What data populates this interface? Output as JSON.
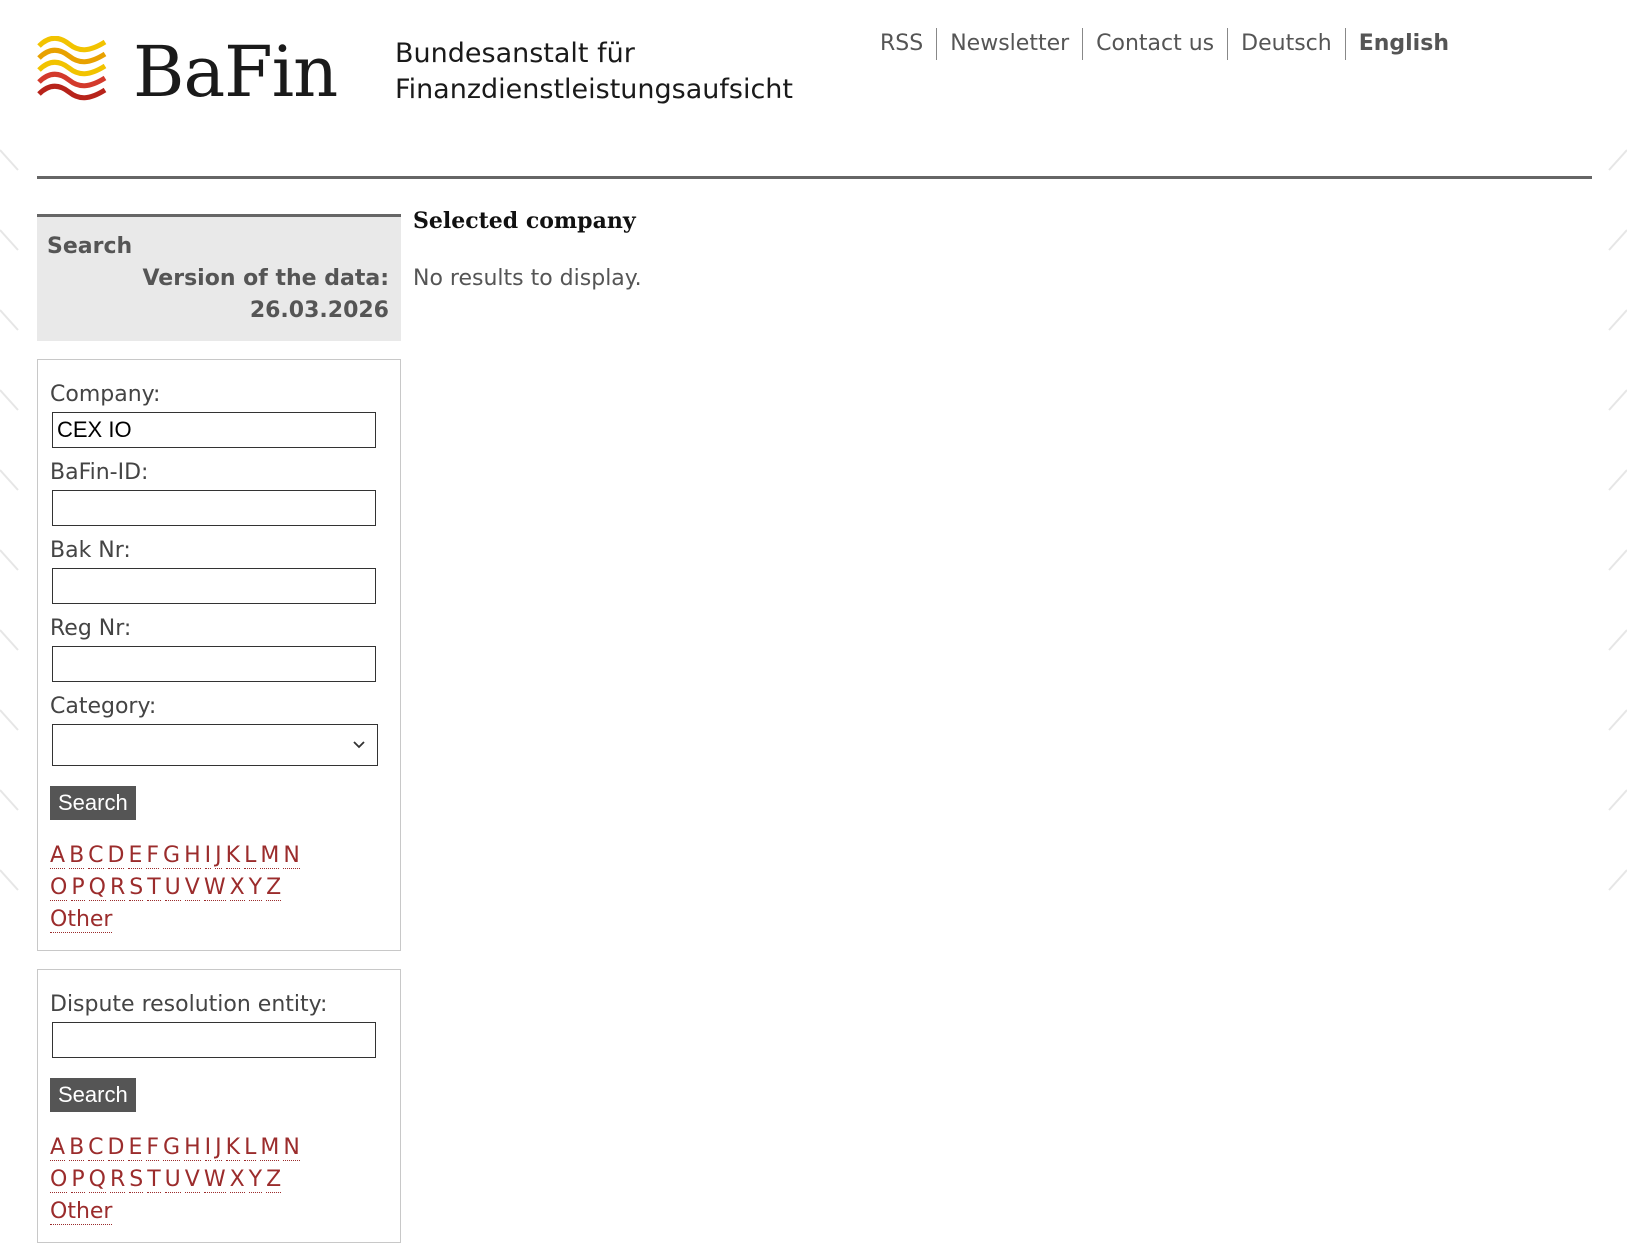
{
  "header": {
    "brand": "BaFin",
    "subtitle_line1": "Bundesanstalt für",
    "subtitle_line2": "Finanzdienstleistungsaufsicht",
    "nav": [
      "RSS",
      "Newsletter",
      "Contact us",
      "Deutsch",
      "English"
    ],
    "active_nav": "English"
  },
  "sidebar": {
    "title": "Search",
    "version_label": "Version of the data:",
    "version_date": "26.03.2026",
    "company_label": "Company:",
    "company_value": "CEX IO",
    "bafin_id_label": "BaFin-ID:",
    "bak_label": "Bak Nr:",
    "reg_label": "Reg Nr:",
    "category_label": "Category:",
    "search_button": "Search",
    "letters_row1": [
      "A",
      "B",
      "C",
      "D",
      "E",
      "F",
      "G",
      "H",
      "I",
      "J",
      "K",
      "L",
      "M",
      "N"
    ],
    "letters_row2": [
      "O",
      "P",
      "Q",
      "R",
      "S",
      "T",
      "U",
      "V",
      "W",
      "X",
      "Y",
      "Z"
    ],
    "other_label": "Other",
    "dispute_label": "Dispute resolution entity:",
    "dispute_button": "Search"
  },
  "main": {
    "heading": "Selected company",
    "message": "No results to display."
  },
  "colors": {
    "link": "#9b2c2c",
    "button_bg": "#555555",
    "panel_bg": "#e9e9e9"
  }
}
